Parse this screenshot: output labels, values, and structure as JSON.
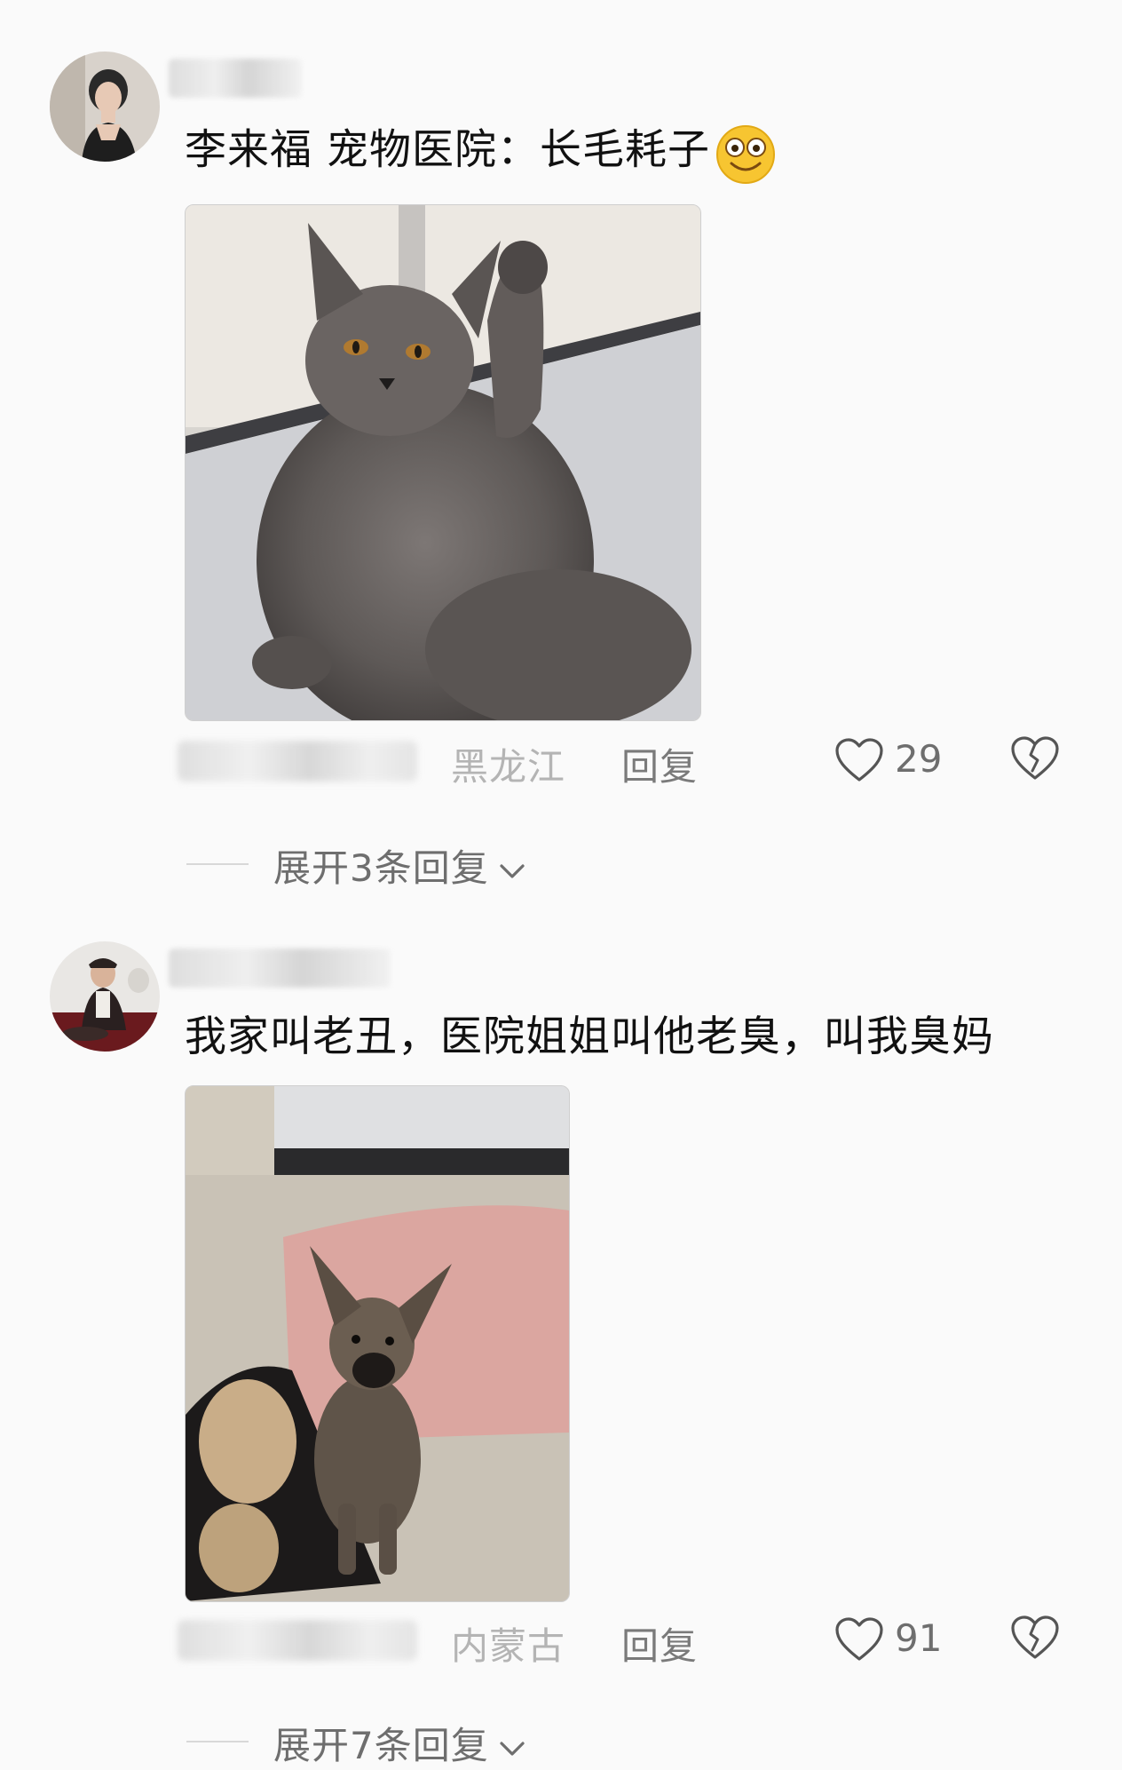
{
  "comments": [
    {
      "text": "李来福 宠物医院：长毛耗子",
      "location": "黑龙江",
      "reply_label": "回复",
      "likes": "29",
      "expand_label": "展开3条回复",
      "emoji": "smiley-face-emoji",
      "photo": "gray-longhair-cat-photo"
    },
    {
      "text": "我家叫老丑，医院姐姐叫他老臭，叫我臭妈",
      "location": "内蒙古",
      "reply_label": "回复",
      "likes": "91",
      "expand_label": "展开7条回复",
      "photo": "brindle-puppy-on-sofa-photo"
    }
  ],
  "colors": {
    "background": "#fafafa",
    "text": "#111111",
    "meta_gray": "#7a7a7a",
    "location_gray": "#b4b4b4"
  },
  "icons": [
    "heart-outline-icon",
    "broken-heart-icon",
    "chevron-down-icon"
  ]
}
